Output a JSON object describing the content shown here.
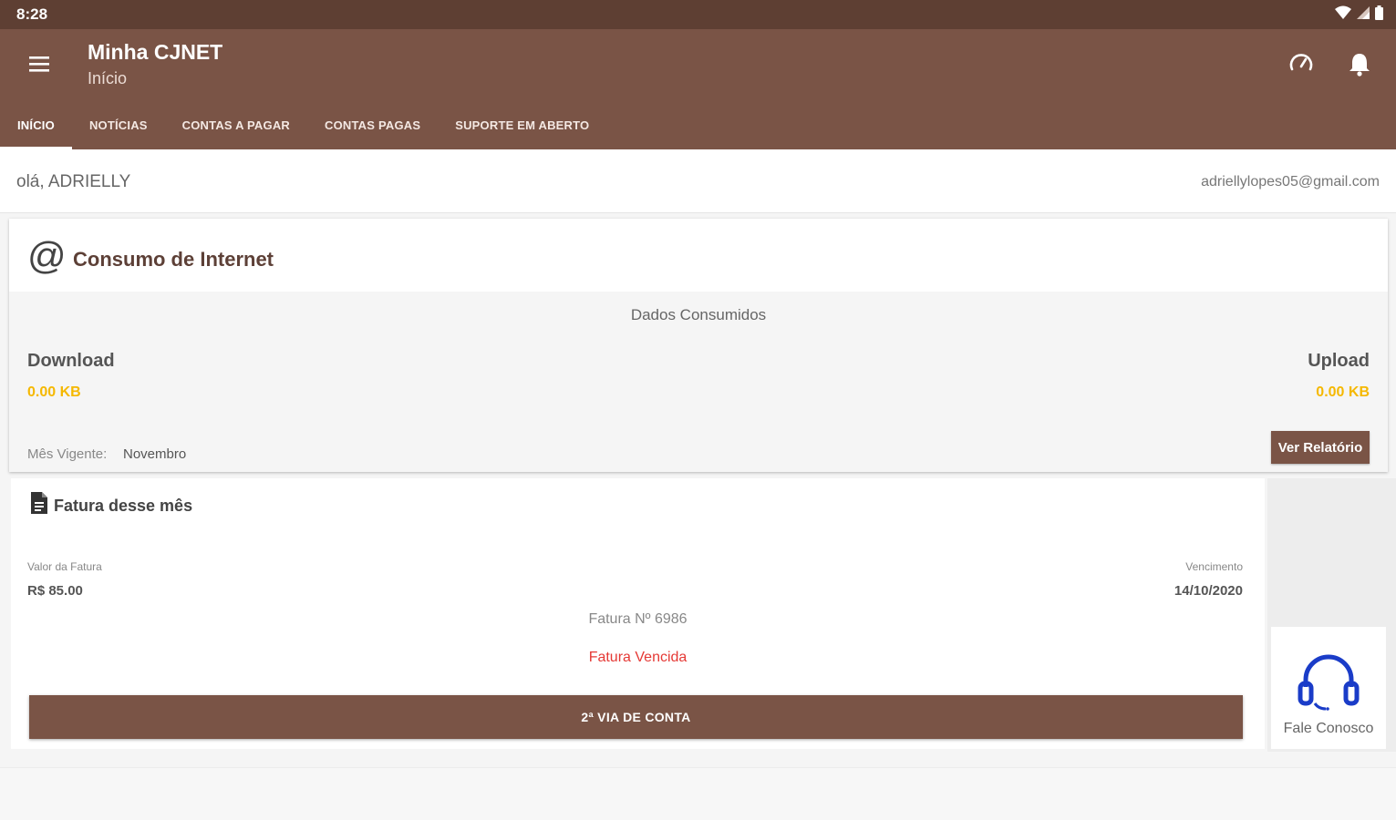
{
  "status_bar": {
    "time": "8:28"
  },
  "app_bar": {
    "title": "Minha CJNET",
    "subtitle": "Início",
    "actions": [
      "speed-gauge-icon",
      "bell-icon"
    ]
  },
  "tabs": [
    {
      "label": "INÍCIO",
      "active": true
    },
    {
      "label": "NOTÍCIAS",
      "active": false
    },
    {
      "label": "CONTAS A PAGAR",
      "active": false
    },
    {
      "label": "CONTAS PAGAS",
      "active": false
    },
    {
      "label": "SUPORTE EM ABERTO",
      "active": false
    }
  ],
  "greeting": {
    "text": "olá, ADRIELLY",
    "email": "adriellylopes05@gmail.com"
  },
  "usage": {
    "title": "Consumo de Internet",
    "subtitle": "Dados Consumidos",
    "download_label": "Download",
    "download_value": "0.00 KB",
    "upload_label": "Upload",
    "upload_value": "0.00 KB",
    "month_label": "Mês Vigente:",
    "month_value": "Novembro",
    "report_button": "Ver Relatório"
  },
  "invoice": {
    "title": "Fatura desse mês",
    "value_label": "Valor da Fatura",
    "value": "R$ 85.00",
    "due_label": "Vencimento",
    "due_date": "14/10/2020",
    "number": "Fatura Nº 6986",
    "status": "Fatura Vencida",
    "second_copy_button": "2ª VIA DE CONTA"
  },
  "contact": {
    "label": "Fale Conosco"
  },
  "colors": {
    "status_bar": "#5e3f33",
    "primary": "#7a5446",
    "accent_value": "#f5b800",
    "overdue": "#e53935",
    "contact_icon": "#1a3cc8"
  }
}
